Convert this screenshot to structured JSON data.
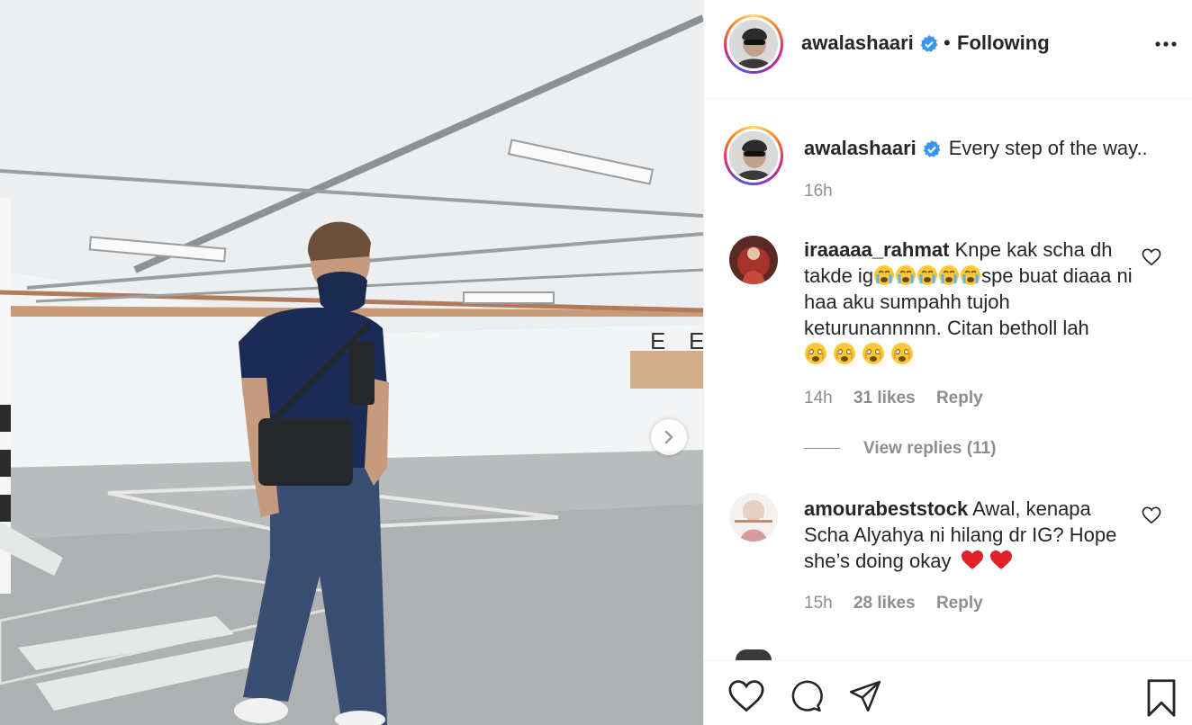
{
  "post": {
    "username": "awalashaari",
    "follow_label": "Following",
    "separator": "•",
    "caption": "Every step of the way..",
    "time": "16h"
  },
  "comments": [
    {
      "username": "iraaaaa_rahmat",
      "text_1": "Knpe kak scha dh takde ig",
      "text_2": "spe buat diaaa ni haa aku sumpahh tujoh keturunannnnn. Citan betholl lah",
      "time": "14h",
      "likes": "31 likes",
      "reply": "Reply",
      "view_replies": "View replies (11)"
    },
    {
      "username": "amourabeststock",
      "text": "Awal, kenapa Scha Alyahya ni hilang dr IG? Hope she’s doing okay",
      "time": "15h",
      "likes": "28 likes",
      "reply": "Reply"
    }
  ],
  "icons": {
    "verified": "verified-badge-icon",
    "more": "more-options-icon",
    "next": "chevron-right-icon",
    "like": "heart-icon",
    "comment": "comment-icon",
    "share": "paper-plane-icon",
    "save": "bookmark-icon",
    "crying_emoji": "loudly-crying-face-emoji",
    "fear_emoji": "fearful-face-emoji",
    "red_heart_emoji": "red-heart-emoji"
  },
  "colors": {
    "verified": "#3897f0",
    "secondary_text": "#8e8e8e",
    "primary_text": "#262626"
  }
}
